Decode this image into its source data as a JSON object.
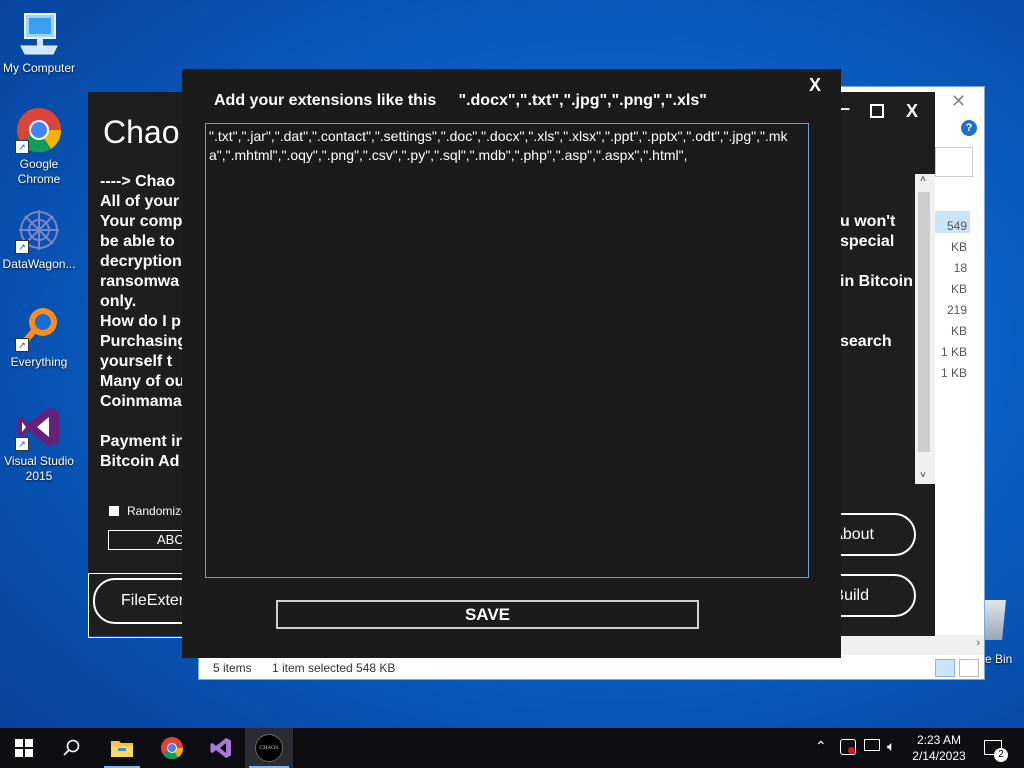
{
  "desktop": {
    "icons": [
      {
        "label": "My Computer"
      },
      {
        "label": "Google Chrome"
      },
      {
        "label": "DataWagon..."
      },
      {
        "label": "Everything"
      },
      {
        "label": "Visual Studio 2015"
      }
    ],
    "recycle_bin_label": "e Bin"
  },
  "explorer": {
    "file_sizes": [
      "549 KB",
      "18 KB",
      "219 KB",
      "1 KB",
      "1 KB"
    ],
    "status_items": "5 items",
    "status_selected": "1 item selected  548 KB"
  },
  "builder": {
    "title": "Chao",
    "lines": [
      "----> Chao",
      "All of your",
      "Your comp",
      "be able to",
      "decryption",
      "ransomwa",
      "only.",
      "How do I p",
      "Purchasing",
      "yourself  t",
      "Many of ou",
      "Coinmama",
      "",
      "Payment in",
      "Bitcoin Ad"
    ],
    "right_lines": [
      "u won't",
      "special",
      "",
      "in Bitcoin",
      "",
      "",
      "search"
    ],
    "randomize_label": "Randomize",
    "abc_label": "ABC",
    "fileext_label": "FileExten",
    "about_label": "About",
    "build_label": "Build",
    "window_controls": {
      "minimize": "–",
      "maximize": "☐",
      "close": "X"
    }
  },
  "dialog": {
    "title": "Add your extensions like this     \".docx\",\".txt\",\".jpg\",\".png\",\".xls\"",
    "close_label": "X",
    "extensions_text": "\".txt\",\".jar\",\".dat\",\".contact\",\".settings\",\".doc\",\".docx\",\".xls\",\".xlsx\",\".ppt\",\".pptx\",\".odt\",\".jpg\",\".mka\",\".mhtml\",\".oqy\",\".png\",\".csv\",\".py\",\".sql\",\".mdb\",\".php\",\".asp\",\".aspx\",\".html\",",
    "save_label": "SAVE"
  },
  "taskbar": {
    "time": "2:23 AM",
    "date": "2/14/2023",
    "notifications": "2",
    "chaos_label": "CHAOS"
  }
}
